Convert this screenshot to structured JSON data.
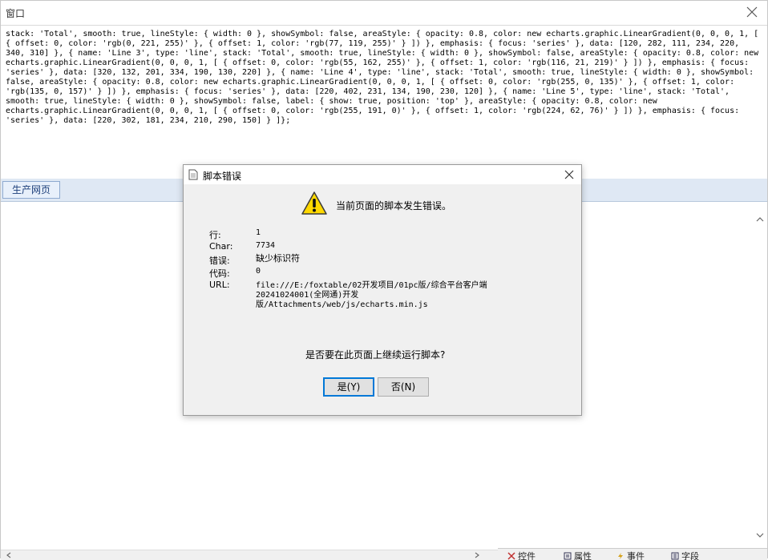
{
  "window": {
    "title": "窗口"
  },
  "code_text": "stack: 'Total',      smooth: true,      lineStyle: {        width: 0      },      showSymbol: false,      areaStyle: {        opacity: 0.8,        color: new echarts.graphic.LinearGradient(0, 0, 0, 1, [          {            offset: 0,            color: 'rgb(0, 221, 255)'          },          {            offset: 1,            color: 'rgb(77, 119, 255)'          }        ])      },      emphasis: {        focus: 'series'      },      data: [120, 282, 111, 234, 220, 340, 310]    },    {      name: 'Line 3',      type: 'line',      stack: 'Total',      smooth: true,      lineStyle: {        width: 0      },      showSymbol: false,      areaStyle: {        opacity: 0.8,        color: new echarts.graphic.LinearGradient(0, 0, 0, 1, [          {            offset: 0,            color: 'rgb(55, 162, 255)'          },          {            offset: 1,            color: 'rgb(116, 21, 219)'          }        ])      },      emphasis: {        focus: 'series'      },      data: [320, 132, 201, 334, 190, 130, 220]    },    {      name: 'Line 4',      type: 'line',      stack: 'Total',      smooth: true,      lineStyle: {        width: 0      },      showSymbol: false,      areaStyle: {        opacity: 0.8,        color: new echarts.graphic.LinearGradient(0, 0, 0, 1, [          {            offset: 0,            color: 'rgb(255, 0, 135)'          },          {            offset: 1,            color: 'rgb(135, 0, 157)'          }        ])      },      emphasis: {        focus: 'series'      },      data: [220, 402, 231, 134, 190, 230, 120]    },    {      name: 'Line 5',      type: 'line',      stack: 'Total',      smooth: true,      lineStyle: {        width: 0      },      showSymbol: false,      label: {        show: true,        position: 'top'      },      areaStyle: {        opacity: 0.8,        color: new echarts.graphic.LinearGradient(0, 0, 0, 1, [          {            offset: 0,            color: 'rgb(255, 191, 0)'          },          {            offset: 1,            color: 'rgb(224, 62, 76)'          }        ])      },      emphasis: {        focus: 'series'      },      data: [220, 302, 181, 234, 210, 290, 150]    }  ]};",
  "tab": {
    "label": "生产网页"
  },
  "statusbar": {
    "items": [
      "控件",
      "属性",
      "事件",
      "字段"
    ]
  },
  "dialog": {
    "title": "脚本错误",
    "message": "当前页面的脚本发生错误。",
    "line_label": "行:",
    "line_value": "1",
    "char_label": "Char:",
    "char_value": "7734",
    "error_label": "错误:",
    "error_value": "缺少标识符",
    "code_label": "代码:",
    "code_value": "0",
    "url_label": "URL:",
    "url_value": "file:///E:/foxtable/02开发项目/01pc版/综合平台客户端20241024001(全网通)开发版/Attachments/web/js/echarts.min.js",
    "question": "是否要在此页面上继续运行脚本?",
    "yes_label": "是(Y)",
    "no_label": "否(N)"
  },
  "colors": {
    "warning_yellow": "#ffd800",
    "accent_blue": "#0078d7"
  }
}
